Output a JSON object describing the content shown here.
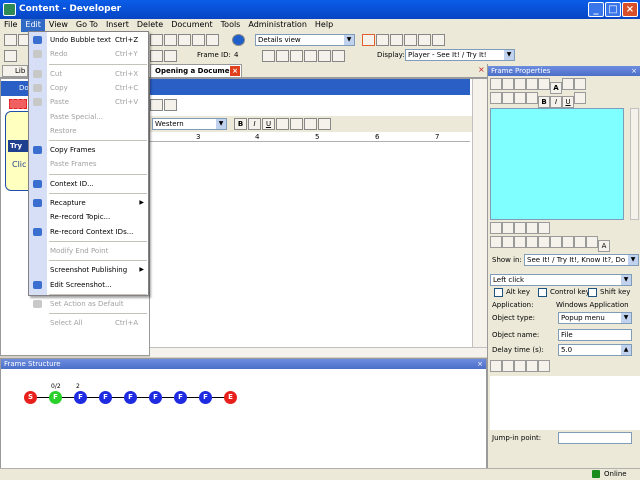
{
  "window": {
    "title": "Content - Developer"
  },
  "menubar": [
    "File",
    "Edit",
    "View",
    "Go To",
    "Insert",
    "Delete",
    "Document",
    "Tools",
    "Administration",
    "Help"
  ],
  "toolbar": {
    "view_combo": "Details view",
    "frame_id_label": "Frame ID:",
    "frame_id_value": "4",
    "display_label": "Display:",
    "display_value": "Player - See It! / Try It!"
  },
  "tabs": {
    "lib": "Lib",
    "doc": "Opening a Document"
  },
  "left_panel": {
    "label1": "Do",
    "try_label": "Try",
    "click_label": "Clic"
  },
  "editor": {
    "font_combo": "Western",
    "ruler_marks": [
      "3",
      "4",
      "5",
      "6",
      "7"
    ]
  },
  "edit_menu": [
    {
      "label": "Undo Bubble text",
      "shortcut": "Ctrl+Z",
      "disabled": false,
      "icon": "undo-icon"
    },
    {
      "label": "Redo",
      "shortcut": "Ctrl+Y",
      "disabled": true,
      "icon": "redo-icon"
    },
    {
      "sep": true
    },
    {
      "label": "Cut",
      "shortcut": "Ctrl+X",
      "disabled": true,
      "icon": "cut-icon"
    },
    {
      "label": "Copy",
      "shortcut": "Ctrl+C",
      "disabled": true,
      "icon": "copy-icon"
    },
    {
      "label": "Paste",
      "shortcut": "Ctrl+V",
      "disabled": true,
      "icon": "paste-icon"
    },
    {
      "label": "Paste Special...",
      "shortcut": "",
      "disabled": true,
      "icon": ""
    },
    {
      "label": "Restore",
      "shortcut": "",
      "disabled": true,
      "icon": ""
    },
    {
      "sep": true
    },
    {
      "label": "Copy Frames",
      "shortcut": "",
      "disabled": false,
      "icon": "copy-frames-icon"
    },
    {
      "label": "Paste Frames",
      "shortcut": "",
      "disabled": true,
      "icon": ""
    },
    {
      "sep": true
    },
    {
      "label": "Context ID...",
      "shortcut": "",
      "disabled": false,
      "icon": "context-id-icon"
    },
    {
      "sep": true
    },
    {
      "label": "Recapture",
      "shortcut": "",
      "disabled": false,
      "icon": "recapture-icon",
      "submenu": true
    },
    {
      "label": "Re-record Topic...",
      "shortcut": "",
      "disabled": false,
      "icon": ""
    },
    {
      "label": "Re-record Context IDs...",
      "shortcut": "",
      "disabled": false,
      "icon": "rerecord-icon"
    },
    {
      "sep": true
    },
    {
      "label": "Modify End Point",
      "shortcut": "",
      "disabled": true,
      "icon": ""
    },
    {
      "sep": true
    },
    {
      "label": "Screenshot Publishing",
      "shortcut": "",
      "disabled": false,
      "icon": "",
      "submenu": true
    },
    {
      "label": "Edit Screenshot...",
      "shortcut": "",
      "disabled": false,
      "icon": "edit-screenshot-icon"
    },
    {
      "sep": true
    },
    {
      "label": "Set Action as Default",
      "shortcut": "",
      "disabled": true,
      "icon": "set-default-icon"
    },
    {
      "sep": true
    },
    {
      "label": "Select All",
      "shortcut": "Ctrl+A",
      "disabled": true,
      "icon": ""
    }
  ],
  "frame_structure": {
    "title": "Frame Structure",
    "nodes": [
      {
        "label": "S",
        "color": "#E8201C"
      },
      {
        "label": "F",
        "color": "#2BD12B",
        "top": "0/2"
      },
      {
        "label": "F",
        "color": "#1F2BE0",
        "top": "2"
      },
      {
        "label": "F",
        "color": "#1F2BE0"
      },
      {
        "label": "F",
        "color": "#1F2BE0"
      },
      {
        "label": "F",
        "color": "#1F2BE0"
      },
      {
        "label": "F",
        "color": "#1F2BE0"
      },
      {
        "label": "F",
        "color": "#1F2BE0"
      },
      {
        "label": "E",
        "color": "#E8201C"
      }
    ]
  },
  "frame_properties": {
    "title": "Frame Properties",
    "show_in_label": "Show in:",
    "show_in_value": "See It! / Try It!, Know It?, Do It!",
    "action": "Left click",
    "alt_key": "Alt key",
    "control_key": "Control key",
    "shift_key": "Shift key",
    "application_label": "Application:",
    "application_value": "Windows Application",
    "object_type_label": "Object type:",
    "object_type_value": "Popup menu",
    "object_name_label": "Object name:",
    "object_name_value": "File",
    "delay_label": "Delay time (s):",
    "delay_value": "5.0",
    "jump_label": "Jump-in point:"
  },
  "status": {
    "online": "Online"
  },
  "colors": {
    "accent": "#316AC5",
    "props_preview": "#7FFFFF"
  }
}
